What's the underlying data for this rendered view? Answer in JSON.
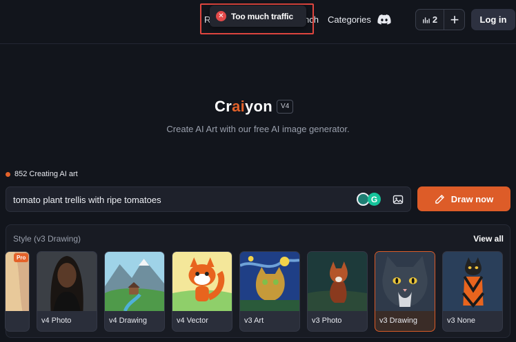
{
  "header": {
    "nav_r": "R",
    "nav_search": "nch",
    "nav_categories": "Categories",
    "credits": "2",
    "login_label": "Log in"
  },
  "toast": {
    "message": "Too much traffic"
  },
  "hero": {
    "logo_pre": "Cr",
    "logo_ai": "ai",
    "logo_post": "yon",
    "version": "V4",
    "subtitle": "Create AI Art with our free AI image generator."
  },
  "status": {
    "text": "852 Creating AI art"
  },
  "prompt": {
    "value": "tomato plant trellis with ripe tomatoes",
    "draw_label": "Draw now"
  },
  "styles": {
    "title": "Style (v3 Drawing)",
    "view_all": "View all",
    "pro_badge": "Pro",
    "items": [
      {
        "label": ""
      },
      {
        "label": "v4 Photo"
      },
      {
        "label": "v4 Drawing"
      },
      {
        "label": "v4 Vector"
      },
      {
        "label": "v3 Art"
      },
      {
        "label": "v3 Photo"
      },
      {
        "label": "v3 Drawing"
      },
      {
        "label": "v3 None"
      }
    ]
  },
  "colors": {
    "accent": "#dd5c28",
    "error": "#e34a4a",
    "background": "#12151c"
  }
}
